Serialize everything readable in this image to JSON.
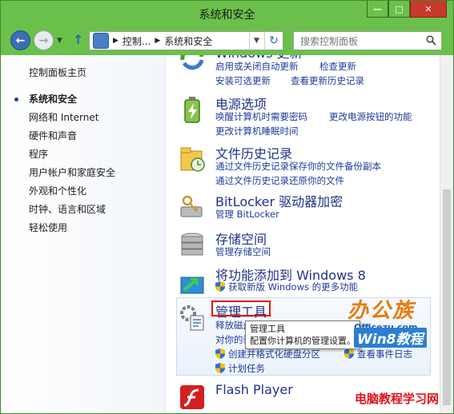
{
  "window": {
    "title": "系统和安全",
    "minimize": "—",
    "maximize": "□",
    "close": "✕"
  },
  "addressbar": {
    "crumbs": [
      "控制...",
      "系统和安全"
    ],
    "search_placeholder": "搜索控制面板"
  },
  "sidebar": {
    "items": [
      {
        "label": "控制面板主页",
        "current": false
      },
      {
        "label": "系统和安全",
        "current": true
      },
      {
        "label": "网络和 Internet",
        "current": false
      },
      {
        "label": "硬件和声音",
        "current": false
      },
      {
        "label": "程序",
        "current": false
      },
      {
        "label": "用户帐户和家庭安全",
        "current": false
      },
      {
        "label": "外观和个性化",
        "current": false
      },
      {
        "label": "时钟、语言和区域",
        "current": false
      },
      {
        "label": "轻松使用",
        "current": false
      }
    ]
  },
  "sections": {
    "update": {
      "title": "Windows 更新",
      "links": [
        "启用或关闭自动更新",
        "检查更新",
        "安装可选更新",
        "查看更新历史记录"
      ]
    },
    "power": {
      "title": "电源选项",
      "links": [
        "唤醒计算机时需要密码",
        "更改电源按钮的功能",
        "更改计算机睡眠时间"
      ]
    },
    "filehistory": {
      "title": "文件历史记录",
      "links": [
        "通过文件历史记录保存你的文件备份副本",
        "通过文件历史记录还原你的文件"
      ]
    },
    "bitlocker": {
      "title": "BitLocker 驱动器加密",
      "links": [
        "管理 BitLocker"
      ]
    },
    "storage": {
      "title": "存储空间",
      "links": [
        "管理存储空间"
      ]
    },
    "addfeatures": {
      "title": "将功能添加到 Windows 8",
      "links": [
        "获取新版 Windows 的更多功能"
      ]
    },
    "admintools": {
      "title": "管理工具",
      "links": [
        "释放磁盘空间",
        "对你的驱动器进行碎片整理和优化",
        "创建并格式化硬盘分区",
        "查看事件日志",
        "计划任务"
      ]
    },
    "flash": {
      "title": "Flash Player"
    }
  },
  "tooltip": {
    "line1": "管理工具",
    "line2": "配置你计算机的管理设置。"
  },
  "watermarks": {
    "brand": "办公族",
    "url": "Officezu.com",
    "badge": "Win8教程",
    "bottom": "电脑教程学习网"
  },
  "colors": {
    "frame": "#6bc04b",
    "link": "#1e3c9c",
    "title": "#1e3287",
    "highlight_box": "#e3160e"
  }
}
